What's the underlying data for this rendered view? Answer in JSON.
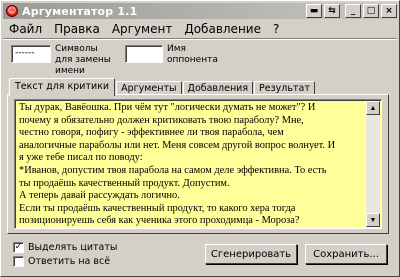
{
  "window": {
    "title": "Аргументатор 1.1",
    "icon_glyph": "☺",
    "titlebar_buttons": [
      "▬",
      "⇆",
      "_",
      "□",
      "×"
    ]
  },
  "menu": [
    "Файл",
    "Правка",
    "Аргумент",
    "Добавление",
    "?"
  ],
  "fields": {
    "symbols": {
      "value": "------",
      "label": "Символы для замены имени"
    },
    "opponent": {
      "value": "",
      "label": "Имя оппонента"
    }
  },
  "tabs": [
    "Текст для критики",
    "Аргументы",
    "Добавления",
    "Результат"
  ],
  "active_tab": 0,
  "text_lines": [
    "Ты дурак, Вавёошка. При чём тут \"логически думать не может\"? И",
    "почему я обязательно должен критиковать твою параболу? Мне,",
    "честно говоря, пофигу - эффективнее ли твоя парабола, чем",
    "аналогичные параболы или нет. Меня совсем другой вопрос волнует. И",
    "я уже тебе писал по поводу:",
    "*Иванов, допустим твоя парабола на самом деле эффективна. То есть",
    "ты продаёшь качественный продукт. Допустим.",
    "А теперь давай рассуждать логично.",
    "Если ты продаёшь качественный продукт, то какого хера тогда",
    "позиционируешь себя как ученика этого проходимца - Мороза?"
  ],
  "checkboxes": [
    {
      "label": "Выделять цитаты",
      "checked": true
    },
    {
      "label": "Ответить на всё",
      "checked": false
    }
  ],
  "buttons": {
    "generate": "Сгенерировать",
    "save": "Сохранить..."
  },
  "colors": {
    "text_bg": "#ffff99",
    "window_bg": "#d4d0c8",
    "app_icon": "#e01010"
  }
}
